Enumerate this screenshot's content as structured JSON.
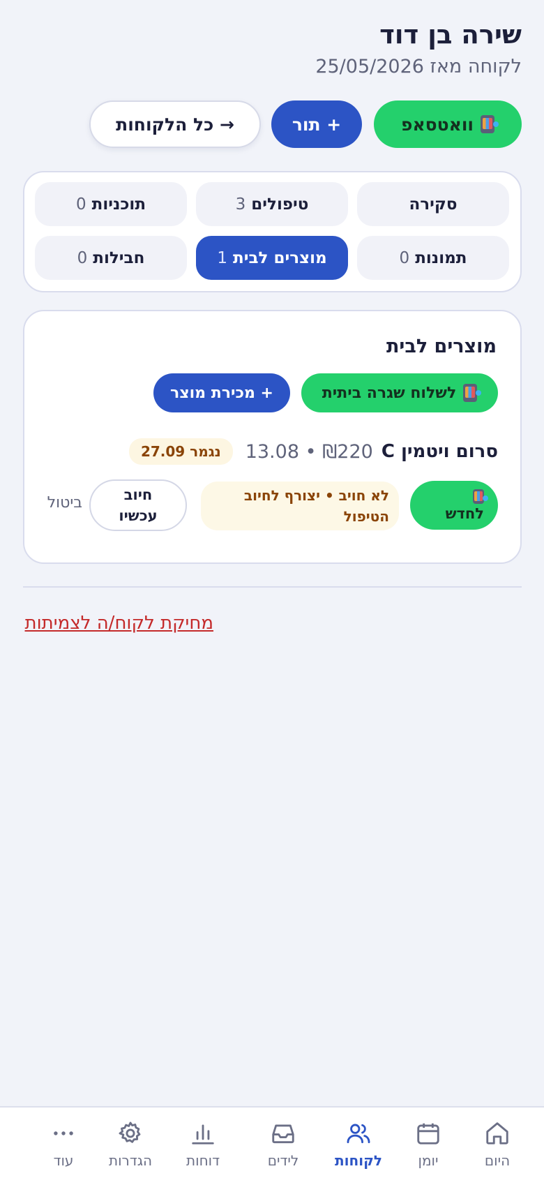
{
  "client": {
    "name": "שירה בן דוד",
    "since": "לקוחה מאז 25/05/2026"
  },
  "actions": {
    "whatsapp": "וואטסאפ",
    "appointment": "+ תור",
    "all_clients": "→ כל הלקוחות"
  },
  "tabs": [
    {
      "label": "סקירה",
      "count": ""
    },
    {
      "label": "טיפולים",
      "count": "3"
    },
    {
      "label": "תוכניות",
      "count": "0"
    },
    {
      "label": "תמונות",
      "count": "0"
    },
    {
      "label": "מוצרים לבית",
      "count": "1"
    },
    {
      "label": "חבילות",
      "count": "0"
    }
  ],
  "active_tab": "מוצרים לבית",
  "products": {
    "title": "מוצרים לבית",
    "send_routine": "לשלוח שגרה ביתית",
    "sell_product": "+ מכירת מוצר",
    "items": [
      {
        "name": "סרום ויטמין C",
        "price_date": "₪220 • 13.08",
        "ends": "נגמר 27.09",
        "renew": "לחדש",
        "status": "לא חויב • יצורף לחיוב הטיפול",
        "charge": "חיוב עכשיו",
        "cancel": "ביטול"
      }
    ]
  },
  "delete_client": "מחיקת לקוח/ה לצמיתות",
  "nav": [
    {
      "label": "היום",
      "icon": "home-icon"
    },
    {
      "label": "יומן",
      "icon": "calendar-icon"
    },
    {
      "label": "לקוחות",
      "icon": "clients-icon"
    },
    {
      "label": "לידים",
      "icon": "inbox-icon"
    },
    {
      "label": "דוחות",
      "icon": "chart-icon"
    },
    {
      "label": "הגדרות",
      "icon": "gear-icon"
    },
    {
      "label": "עוד",
      "icon": "more-icon"
    }
  ],
  "active_nav": "לקוחות",
  "colors": {
    "primary": "#2c54c5",
    "whatsapp_green": "#24d06c",
    "background": "#f1f3f9",
    "danger": "#c42a2a",
    "warning_bg": "#fdf6e2",
    "warning_text": "#8a4407"
  }
}
